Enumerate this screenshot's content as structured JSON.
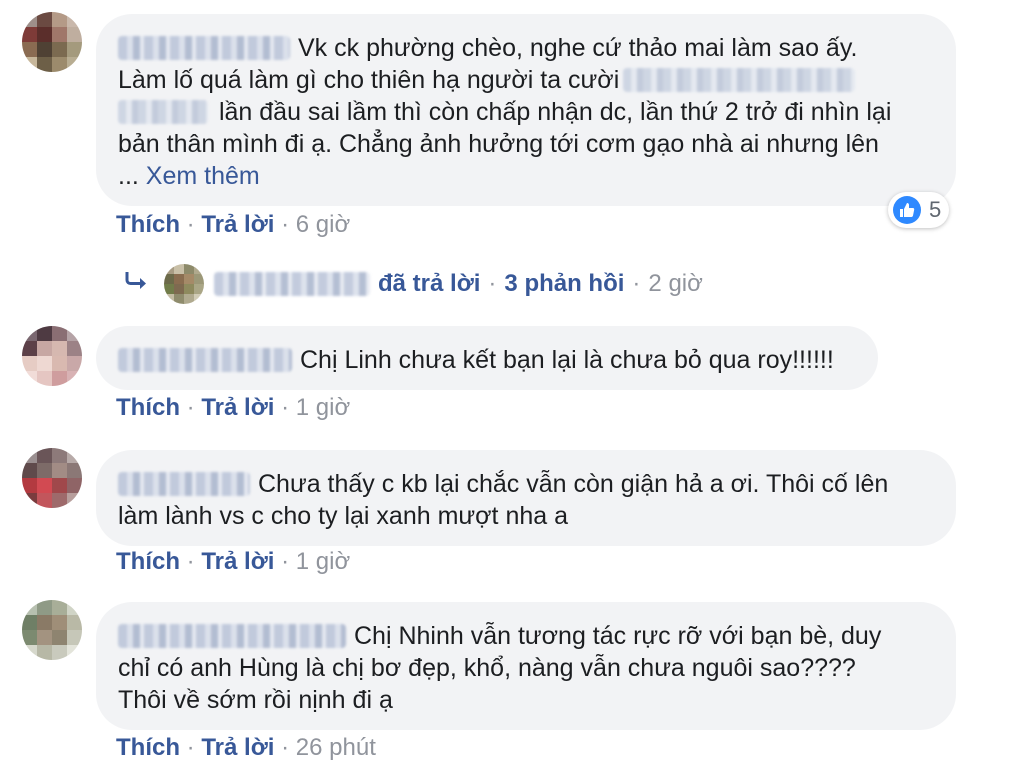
{
  "colors": {
    "link": "#385898",
    "bubble": "#f2f3f5",
    "muted": "#90949c",
    "like_blue": "#2e89ff"
  },
  "comments": [
    {
      "text_line1": "Vk ck phường chèo, nghe cứ thảo mai làm sao ấy.",
      "text_line2": "Làm lố quá làm gì cho thiên hạ người ta cười",
      "text_line3": "lần đầu sai lầm thì còn chấp nhận dc, lần thứ 2 trở đi nhìn lại",
      "text_line4": "bản thân mình đi ạ. Chẳng ảnh hưởng tới cơm gạo nhà ai nhưng lên",
      "ellipsis": "...",
      "see_more": "Xem thêm",
      "like_label": "Thích",
      "reply_label": "Trả lời",
      "sep": "·",
      "time": "6 giờ",
      "reaction_count": "5",
      "reaction_icon": "like-icon",
      "replies": {
        "icon": "reply-arrow-icon",
        "label": "đã trả lời",
        "count_label": "3 phản hồi",
        "time": "2 giờ"
      }
    },
    {
      "text_line1": "Chị Linh chưa kết bạn lại là chưa bỏ qua roy!!!!!!",
      "like_label": "Thích",
      "reply_label": "Trả lời",
      "sep": "·",
      "time": "1 giờ"
    },
    {
      "text_line1": "Chưa thấy c kb lại chắc vẫn còn giận hả a ơi. Thôi cố lên",
      "text_line2": "làm lành vs c cho ty lại xanh mượt nha a",
      "like_label": "Thích",
      "reply_label": "Trả lời",
      "sep": "·",
      "time": "1 giờ"
    },
    {
      "text_line1": "Chị Nhinh vẫn tương tác rực rỡ với bạn bè, duy",
      "text_line2": "chỉ có anh Hùng là chị bơ đẹp, khổ, nàng vẫn chưa nguôi sao????",
      "text_line3": "Thôi về sớm rồi nịnh đi ạ",
      "like_label": "Thích",
      "reply_label": "Trả lời",
      "sep": "·",
      "time": "26 phút"
    }
  ]
}
